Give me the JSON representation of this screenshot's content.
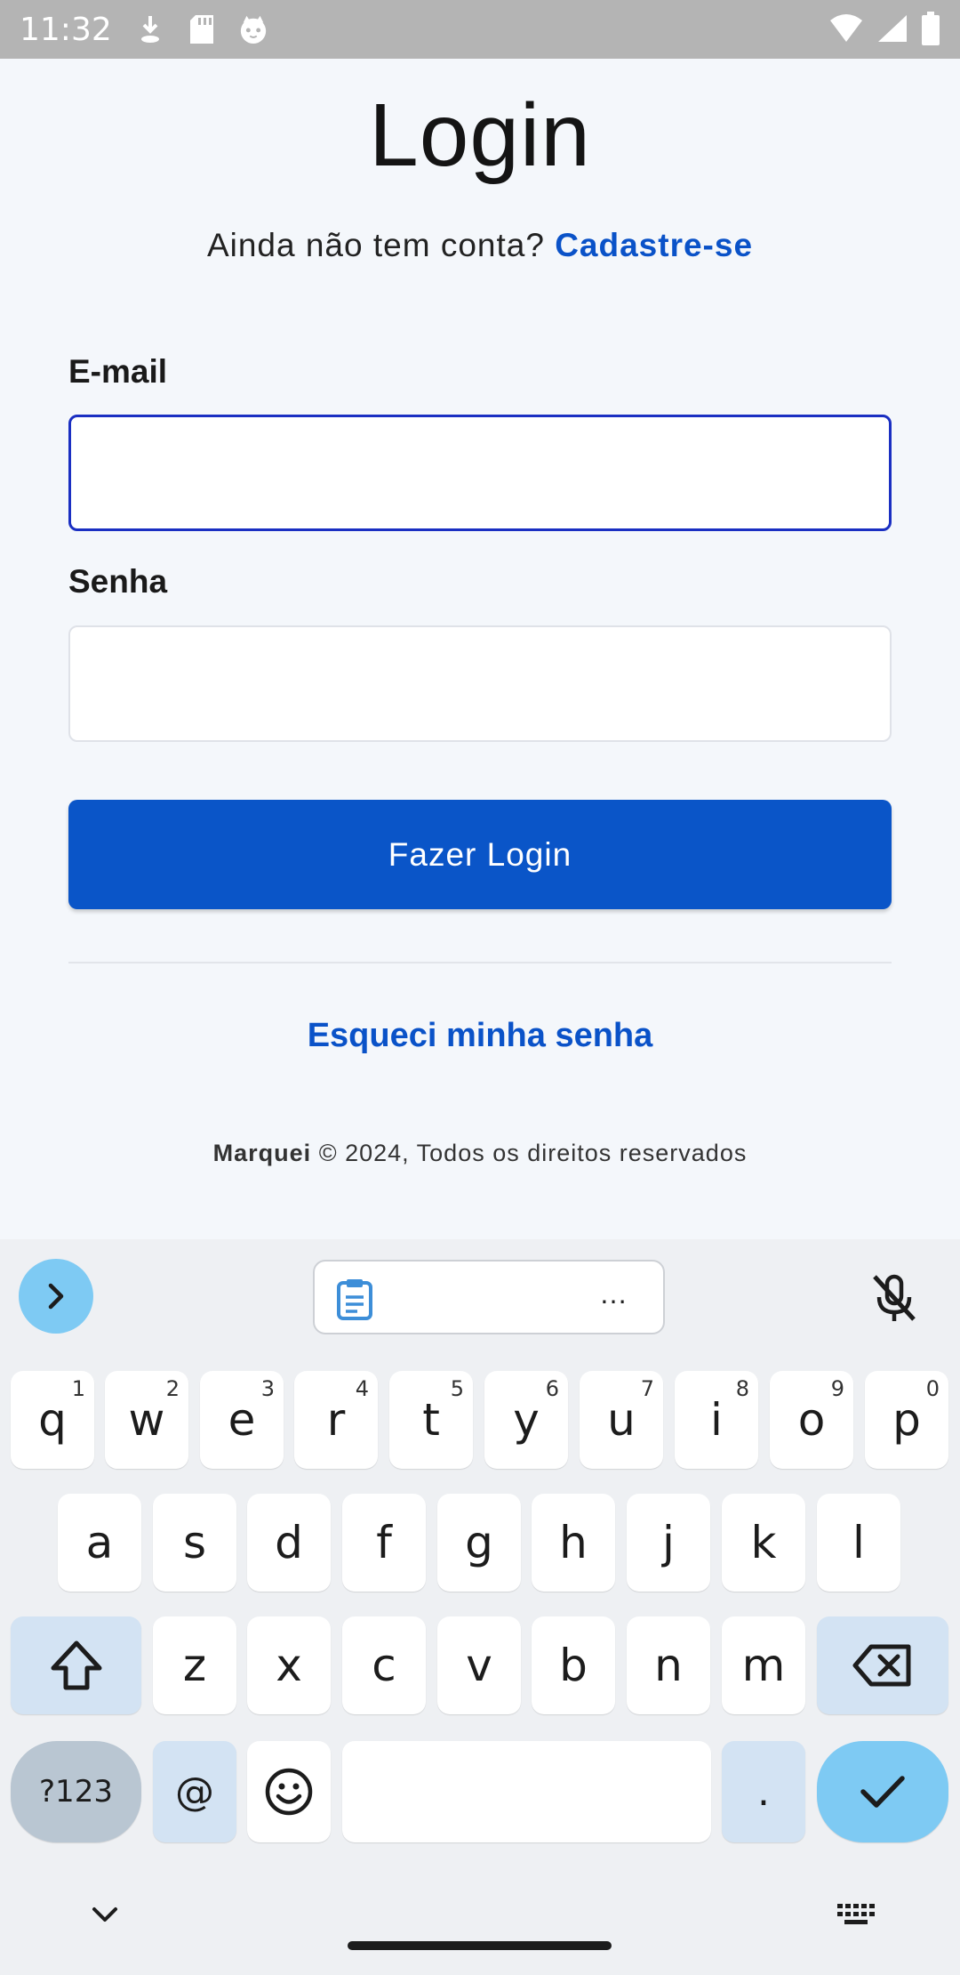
{
  "status_bar": {
    "time": "11:32",
    "left_icons": [
      "download-icon",
      "sd-card-icon",
      "cat-face-icon"
    ],
    "right_icons": [
      "wifi-icon",
      "signal-icon",
      "battery-icon"
    ]
  },
  "login": {
    "title": "Login",
    "no_account_text": "Ainda não tem conta?",
    "signup_link": "Cadastre-se",
    "email_label": "E-mail",
    "email_value": "",
    "password_label": "Senha",
    "password_value": "",
    "submit_label": "Fazer Login",
    "forgot_link": "Esqueci minha senha",
    "footer_brand": "Marquei",
    "footer_text": " © 2024, Todos os direitos reservados"
  },
  "keyboard": {
    "toolbar": {
      "expand_icon": "chevron-right-icon",
      "clipboard_icon": "clipboard-icon",
      "clipboard_more": "…",
      "mic_icon": "mic-off-icon"
    },
    "row1": [
      {
        "key": "q",
        "sup": "1"
      },
      {
        "key": "w",
        "sup": "2"
      },
      {
        "key": "e",
        "sup": "3"
      },
      {
        "key": "r",
        "sup": "4"
      },
      {
        "key": "t",
        "sup": "5"
      },
      {
        "key": "y",
        "sup": "6"
      },
      {
        "key": "u",
        "sup": "7"
      },
      {
        "key": "i",
        "sup": "8"
      },
      {
        "key": "o",
        "sup": "9"
      },
      {
        "key": "p",
        "sup": "0"
      }
    ],
    "row2": [
      "a",
      "s",
      "d",
      "f",
      "g",
      "h",
      "j",
      "k",
      "l"
    ],
    "row3": [
      "z",
      "x",
      "c",
      "v",
      "b",
      "n",
      "m"
    ],
    "symbols_key": "?123",
    "at_key": "@",
    "period_key": ".",
    "space_key": "",
    "nav_icons": [
      "chevron-down-icon",
      "keyboard-icon"
    ],
    "colors": {
      "accent": "#7ecaf3",
      "func_key": "#d3e3f3",
      "symbols_key": "#b9c6d2"
    }
  }
}
